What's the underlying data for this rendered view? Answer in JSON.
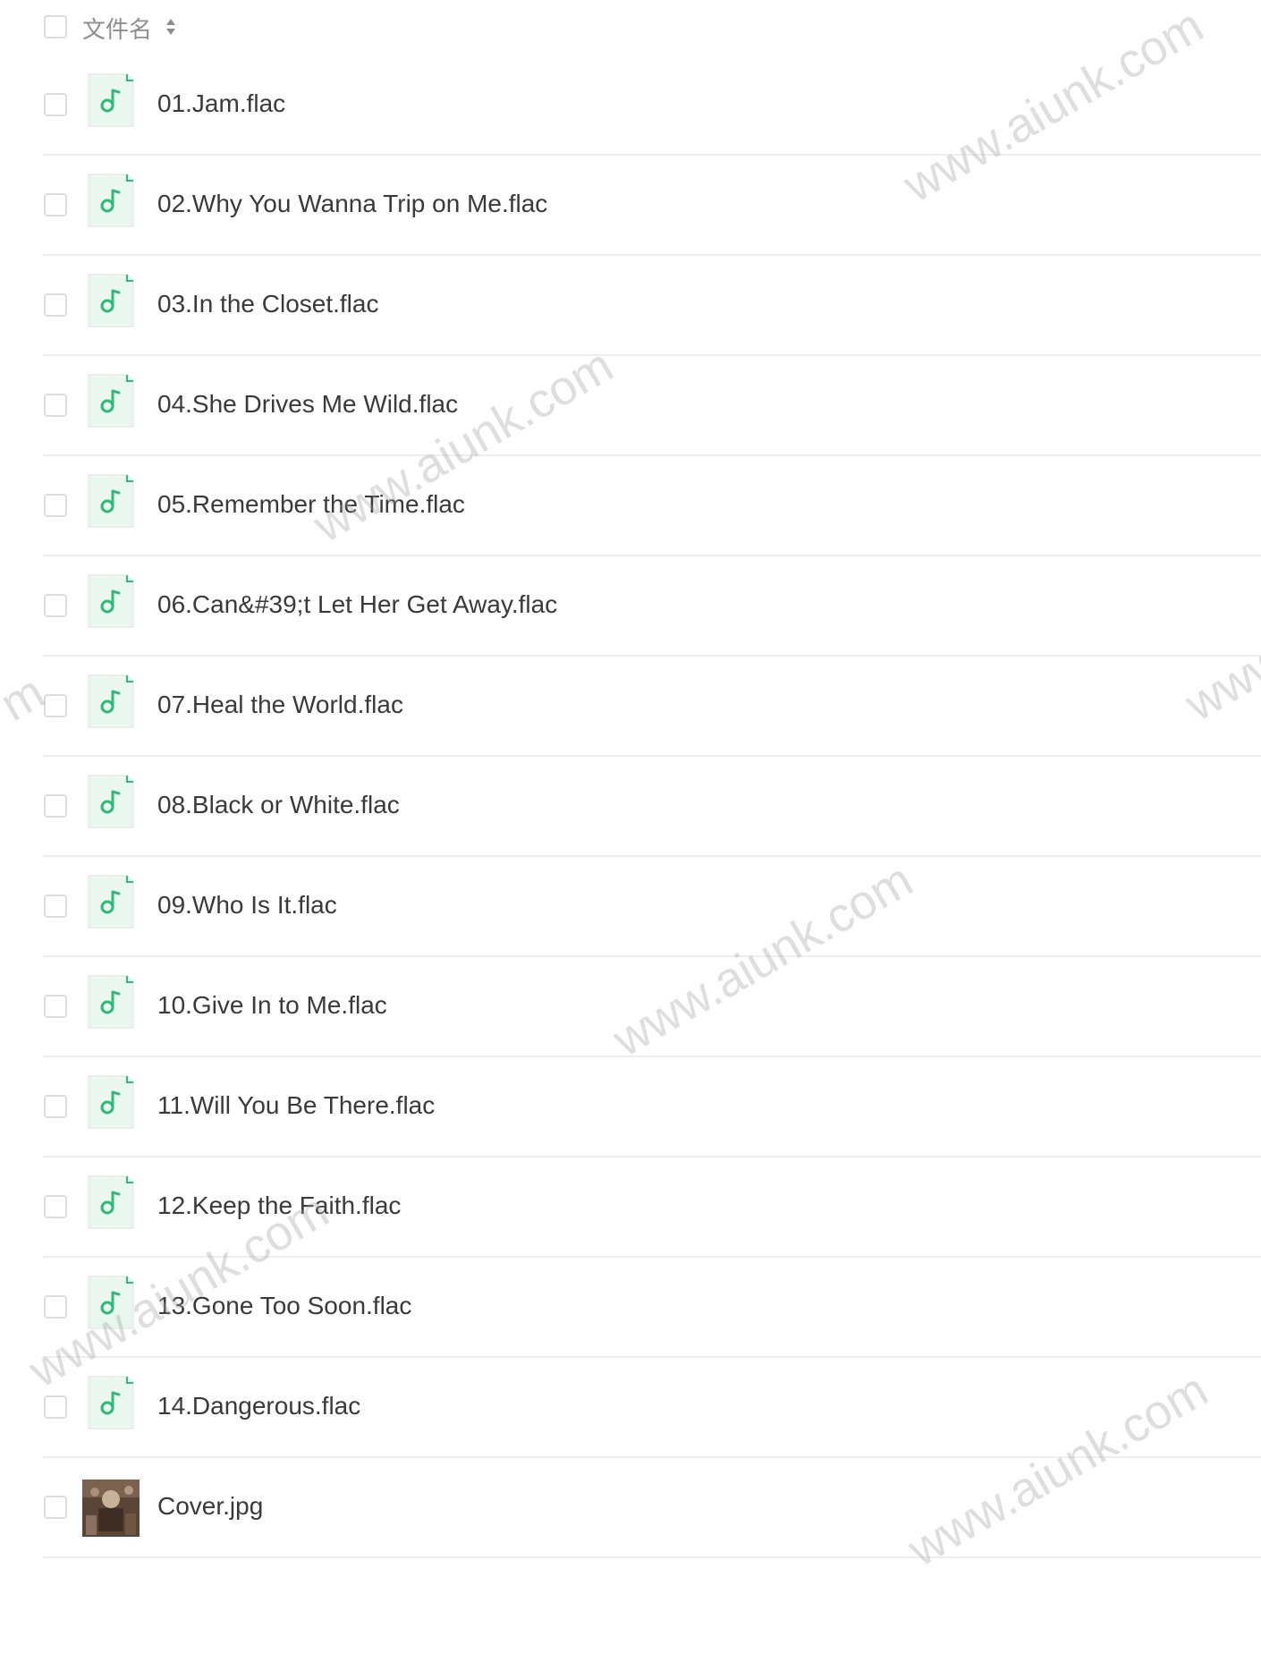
{
  "header": {
    "label": "文件名"
  },
  "files": [
    {
      "name": "01.Jam.flac",
      "icon": "music-file-icon"
    },
    {
      "name": "02.Why You Wanna Trip on Me.flac",
      "icon": "music-file-icon"
    },
    {
      "name": "03.In the Closet.flac",
      "icon": "music-file-icon"
    },
    {
      "name": "04.She Drives Me Wild.flac",
      "icon": "music-file-icon"
    },
    {
      "name": "05.Remember the Time.flac",
      "icon": "music-file-icon"
    },
    {
      "name": "06.Can&#39;t Let Her Get Away.flac",
      "icon": "music-file-icon"
    },
    {
      "name": "07.Heal the World.flac",
      "icon": "music-file-icon"
    },
    {
      "name": "08.Black or White.flac",
      "icon": "music-file-icon"
    },
    {
      "name": "09.Who Is It.flac",
      "icon": "music-file-icon"
    },
    {
      "name": "10.Give In to Me.flac",
      "icon": "music-file-icon"
    },
    {
      "name": "11.Will You Be There.flac",
      "icon": "music-file-icon"
    },
    {
      "name": "12.Keep the Faith.flac",
      "icon": "music-file-icon"
    },
    {
      "name": "13.Gone Too Soon.flac",
      "icon": "music-file-icon"
    },
    {
      "name": "14.Dangerous.flac",
      "icon": "music-file-icon"
    },
    {
      "name": "Cover.jpg",
      "icon": "image-thumbnail"
    }
  ],
  "watermarks": [
    "www.aiunk.com",
    "www.aiunk.com",
    "www.aiunk.com",
    "www.aiunk.com",
    "www.aiunk.com",
    "m",
    "www"
  ],
  "colors": {
    "accent": "#2fb97a",
    "icon_bg": "#e9f7ef",
    "divider": "#eeeeee"
  }
}
